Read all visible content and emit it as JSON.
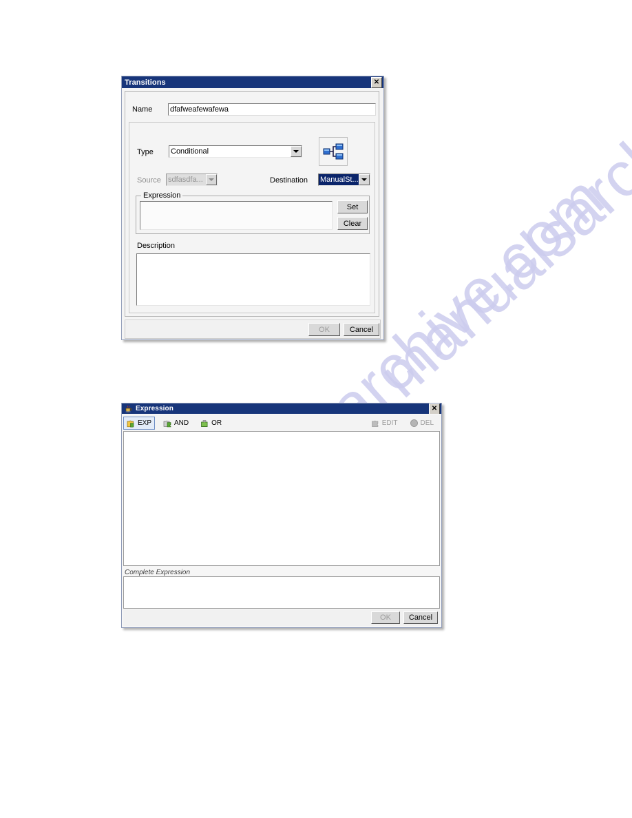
{
  "page": {
    "background": "#ffffff",
    "watermark_text": "manualsarchive.com",
    "watermark_color": "#ccccee"
  },
  "transitions_dialog": {
    "title": "Transitions",
    "close_icon": "close-icon",
    "name_label": "Name",
    "name_value": "dfafweafewafewa",
    "type_label": "Type",
    "type_value": "Conditional",
    "type_options": [
      "Conditional"
    ],
    "flow_icon": "branch-diagram-icon",
    "source_label": "Source",
    "source_value": "sdfasdfa...",
    "source_disabled": true,
    "destination_label": "Destination",
    "destination_value": "ManualSt...",
    "destination_selected": true,
    "expression_group_label": "Expression",
    "expression_value": "",
    "set_label": "Set",
    "clear_label": "Clear",
    "description_label": "Description",
    "description_value": "",
    "ok_label": "OK",
    "ok_disabled": true,
    "cancel_label": "Cancel",
    "titlebar_color": "#17357a",
    "selection_color": "#0a246a"
  },
  "expression_dialog": {
    "title": "Expression",
    "app_icon": "java-cup-icon",
    "close_icon": "close-icon",
    "toolbar": [
      {
        "label": "EXP",
        "icon": "puzzle-piece-yellow-icon",
        "selected": true,
        "disabled": false
      },
      {
        "label": "AND",
        "icon": "puzzle-piece-green-icon",
        "selected": false,
        "disabled": false
      },
      {
        "label": "OR",
        "icon": "puzzle-piece-green-icon",
        "selected": false,
        "disabled": false
      },
      {
        "label": "EDIT",
        "icon": "puzzle-piece-gray-icon",
        "selected": false,
        "disabled": true
      },
      {
        "label": "DEL",
        "icon": "circle-gray-icon",
        "selected": false,
        "disabled": true
      }
    ],
    "canvas_value": "",
    "complete_expression_label": "Complete Expression",
    "complete_expression_value": "",
    "ok_label": "OK",
    "ok_disabled": true,
    "cancel_label": "Cancel",
    "titlebar_color": "#17357a"
  }
}
